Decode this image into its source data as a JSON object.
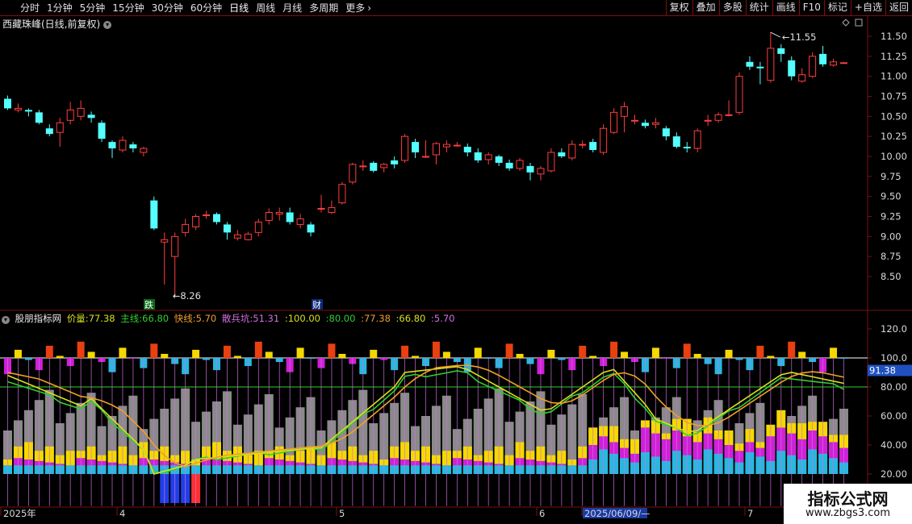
{
  "toolbar": {
    "periods": [
      "分时",
      "1分钟",
      "5分钟",
      "15分钟",
      "30分钟",
      "60分钟",
      "日线",
      "周线",
      "月线",
      "多周期",
      "更多"
    ],
    "active_period": "日线",
    "tools": [
      "复权",
      "叠加",
      "多股",
      "统计",
      "画线",
      "F10",
      "标记",
      "+自选",
      "返回"
    ]
  },
  "stock_title": "西藏珠峰(日线,前复权)",
  "price_axis": [
    "11.50",
    "11.25",
    "11.00",
    "10.75",
    "10.50",
    "10.25",
    "10.00",
    "9.75",
    "9.50",
    "9.25",
    "9.00",
    "8.75",
    "8.50"
  ],
  "high_marker": "11.55",
  "low_marker": "8.26",
  "event_tags": {
    "die": "跌",
    "cai": "财"
  },
  "indicator": {
    "name": "股朋指标网",
    "jialiang_label": "价量:",
    "jialiang": "77.38",
    "zhuxian_label": "主线:",
    "zhuxian": "66.80",
    "kuaixian_label": "快线:",
    "kuaixian": "5.70",
    "sanbing_label": "散兵坑:",
    "sanbing": "51.31",
    "extra": [
      ":100.00",
      ":80.00",
      ":77.38",
      ":66.80",
      ":5.70"
    ],
    "current_value": "91.38",
    "axis": [
      "120.0",
      "100.0",
      "80.00",
      "60.00",
      "40.00",
      "20.00"
    ]
  },
  "date_axis": [
    "2025年",
    "4",
    "5",
    "6",
    "2025/06/09/—",
    "7"
  ],
  "colors": {
    "up": "#ff3d3d",
    "down": "#54ffff",
    "line_yellow": "#d8e01c",
    "line_orange": "#f0a028",
    "line_green": "#2fd02f",
    "line_purple": "#d070e0",
    "bar_gray": "#8a8a8a",
    "bar_yellow": "#f5d800",
    "bar_magenta": "#d020d8",
    "bar_cyan": "#27b8e0",
    "bar_blue": "#1f3fe8"
  },
  "watermark": {
    "line1": "指标公式网",
    "line2": "www.zbgs3.com"
  },
  "chart_data": {
    "type": "candlestick",
    "ylim": [
      8.26,
      11.55
    ],
    "candles": [
      {
        "o": 10.72,
        "c": 10.6,
        "h": 10.76,
        "l": 10.58
      },
      {
        "o": 10.58,
        "c": 10.6,
        "h": 10.66,
        "l": 10.55
      },
      {
        "o": 10.58,
        "c": 10.56,
        "h": 10.6,
        "l": 10.5
      },
      {
        "o": 10.55,
        "c": 10.42,
        "h": 10.58,
        "l": 10.4
      },
      {
        "o": 10.35,
        "c": 10.28,
        "h": 10.4,
        "l": 10.25
      },
      {
        "o": 10.3,
        "c": 10.42,
        "h": 10.48,
        "l": 10.12
      },
      {
        "o": 10.45,
        "c": 10.58,
        "h": 10.68,
        "l": 10.4
      },
      {
        "o": 10.5,
        "c": 10.6,
        "h": 10.7,
        "l": 10.45
      },
      {
        "o": 10.52,
        "c": 10.48,
        "h": 10.56,
        "l": 10.42
      },
      {
        "o": 10.42,
        "c": 10.22,
        "h": 10.45,
        "l": 10.18
      },
      {
        "o": 10.18,
        "c": 10.1,
        "h": 10.2,
        "l": 9.98
      },
      {
        "o": 10.08,
        "c": 10.2,
        "h": 10.25,
        "l": 10.05
      },
      {
        "o": 10.15,
        "c": 10.1,
        "h": 10.18,
        "l": 10.05
      },
      {
        "o": 10.05,
        "c": 10.1,
        "h": 10.12,
        "l": 10.0
      },
      {
        "o": 9.45,
        "c": 9.1,
        "h": 9.5,
        "l": 9.08
      },
      {
        "o": 8.93,
        "c": 8.96,
        "h": 9.05,
        "l": 8.4
      },
      {
        "o": 8.75,
        "c": 9.0,
        "h": 9.05,
        "l": 8.26
      },
      {
        "o": 9.05,
        "c": 9.15,
        "h": 9.22,
        "l": 9.0
      },
      {
        "o": 9.12,
        "c": 9.25,
        "h": 9.28,
        "l": 9.08
      },
      {
        "o": 9.27,
        "c": 9.27,
        "h": 9.32,
        "l": 9.22
      },
      {
        "o": 9.28,
        "c": 9.18,
        "h": 9.3,
        "l": 9.15
      },
      {
        "o": 9.15,
        "c": 9.05,
        "h": 9.18,
        "l": 8.96
      },
      {
        "o": 8.98,
        "c": 9.02,
        "h": 9.08,
        "l": 8.95
      },
      {
        "o": 8.96,
        "c": 9.03,
        "h": 9.06,
        "l": 8.95
      },
      {
        "o": 9.05,
        "c": 9.18,
        "h": 9.22,
        "l": 9.0
      },
      {
        "o": 9.2,
        "c": 9.3,
        "h": 9.35,
        "l": 9.15
      },
      {
        "o": 9.28,
        "c": 9.3,
        "h": 9.36,
        "l": 9.2
      },
      {
        "o": 9.3,
        "c": 9.18,
        "h": 9.36,
        "l": 9.15
      },
      {
        "o": 9.15,
        "c": 9.22,
        "h": 9.28,
        "l": 9.1
      },
      {
        "o": 9.15,
        "c": 9.05,
        "h": 9.18,
        "l": 9.0
      },
      {
        "o": 9.35,
        "c": 9.35,
        "h": 9.52,
        "l": 9.3
      },
      {
        "o": 9.3,
        "c": 9.36,
        "h": 9.45,
        "l": 9.28
      },
      {
        "o": 9.42,
        "c": 9.65,
        "h": 9.68,
        "l": 9.4
      },
      {
        "o": 9.68,
        "c": 9.9,
        "h": 9.92,
        "l": 9.65
      },
      {
        "o": 9.88,
        "c": 9.88,
        "h": 9.95,
        "l": 9.82
      },
      {
        "o": 9.92,
        "c": 9.82,
        "h": 9.94,
        "l": 9.8
      },
      {
        "o": 9.86,
        "c": 9.9,
        "h": 9.92,
        "l": 9.8
      },
      {
        "o": 9.95,
        "c": 9.9,
        "h": 10.0,
        "l": 9.85
      },
      {
        "o": 9.95,
        "c": 10.25,
        "h": 10.28,
        "l": 9.92
      },
      {
        "o": 10.18,
        "c": 10.05,
        "h": 10.22,
        "l": 9.98
      },
      {
        "o": 10.0,
        "c": 10.0,
        "h": 10.2,
        "l": 9.98
      },
      {
        "o": 10.02,
        "c": 10.16,
        "h": 10.18,
        "l": 9.9
      },
      {
        "o": 10.12,
        "c": 10.15,
        "h": 10.2,
        "l": 10.05
      },
      {
        "o": 10.14,
        "c": 10.14,
        "h": 10.18,
        "l": 10.12
      },
      {
        "o": 10.12,
        "c": 10.05,
        "h": 10.16,
        "l": 10.0
      },
      {
        "o": 10.05,
        "c": 9.95,
        "h": 10.1,
        "l": 9.92
      },
      {
        "o": 9.96,
        "c": 10.02,
        "h": 10.05,
        "l": 9.9
      },
      {
        "o": 10.0,
        "c": 9.92,
        "h": 10.02,
        "l": 9.88
      },
      {
        "o": 9.92,
        "c": 9.85,
        "h": 9.96,
        "l": 9.82
      },
      {
        "o": 9.85,
        "c": 9.95,
        "h": 9.98,
        "l": 9.82
      },
      {
        "o": 9.88,
        "c": 9.8,
        "h": 9.92,
        "l": 9.7
      },
      {
        "o": 9.78,
        "c": 9.85,
        "h": 9.88,
        "l": 9.7
      },
      {
        "o": 9.82,
        "c": 10.05,
        "h": 10.1,
        "l": 9.8
      },
      {
        "o": 10.05,
        "c": 10.0,
        "h": 10.1,
        "l": 9.98
      },
      {
        "o": 9.98,
        "c": 10.15,
        "h": 10.2,
        "l": 9.95
      },
      {
        "o": 10.15,
        "c": 10.15,
        "h": 10.2,
        "l": 10.1
      },
      {
        "o": 10.18,
        "c": 10.08,
        "h": 10.22,
        "l": 10.05
      },
      {
        "o": 10.05,
        "c": 10.35,
        "h": 10.4,
        "l": 10.02
      },
      {
        "o": 10.3,
        "c": 10.55,
        "h": 10.6,
        "l": 10.28
      },
      {
        "o": 10.5,
        "c": 10.62,
        "h": 10.68,
        "l": 10.3
      },
      {
        "o": 10.45,
        "c": 10.45,
        "h": 10.52,
        "l": 10.4
      },
      {
        "o": 10.42,
        "c": 10.38,
        "h": 10.46,
        "l": 10.35
      },
      {
        "o": 10.4,
        "c": 10.42,
        "h": 10.48,
        "l": 10.35
      },
      {
        "o": 10.35,
        "c": 10.25,
        "h": 10.38,
        "l": 10.2
      },
      {
        "o": 10.25,
        "c": 10.12,
        "h": 10.3,
        "l": 10.1
      },
      {
        "o": 10.12,
        "c": 10.1,
        "h": 10.18,
        "l": 10.05
      },
      {
        "o": 10.1,
        "c": 10.32,
        "h": 10.35,
        "l": 10.05
      },
      {
        "o": 10.45,
        "c": 10.45,
        "h": 10.52,
        "l": 10.38
      },
      {
        "o": 10.45,
        "c": 10.52,
        "h": 10.55,
        "l": 10.42
      },
      {
        "o": 10.52,
        "c": 10.52,
        "h": 10.7,
        "l": 10.5
      },
      {
        "o": 10.55,
        "c": 11.0,
        "h": 11.05,
        "l": 10.52
      },
      {
        "o": 11.18,
        "c": 11.12,
        "h": 11.25,
        "l": 11.08
      },
      {
        "o": 11.12,
        "c": 11.1,
        "h": 11.18,
        "l": 10.9
      },
      {
        "o": 10.95,
        "c": 11.35,
        "h": 11.55,
        "l": 10.92
      },
      {
        "o": 11.35,
        "c": 11.28,
        "h": 11.4,
        "l": 11.18
      },
      {
        "o": 11.2,
        "c": 11.0,
        "h": 11.25,
        "l": 10.95
      },
      {
        "o": 10.94,
        "c": 11.02,
        "h": 11.1,
        "l": 10.92
      },
      {
        "o": 11.0,
        "c": 11.25,
        "h": 11.3,
        "l": 10.98
      },
      {
        "o": 11.28,
        "c": 11.15,
        "h": 11.38,
        "l": 11.12
      },
      {
        "o": 11.14,
        "c": 11.18,
        "h": 11.22,
        "l": 11.12
      },
      {
        "o": 11.17,
        "c": 11.17,
        "h": 11.18,
        "l": 11.16
      }
    ]
  }
}
